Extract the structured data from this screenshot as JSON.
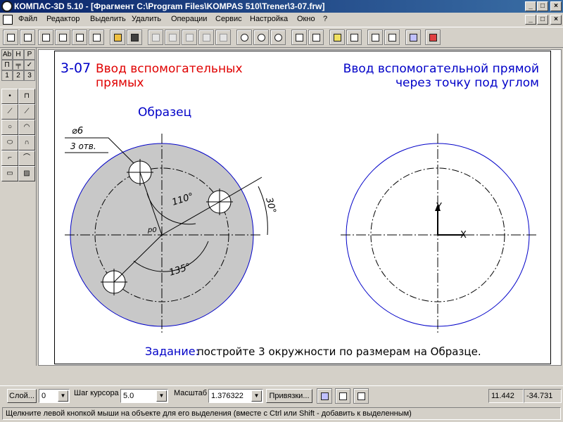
{
  "window": {
    "title": "КОМПАС-3D 5.10 - [Фрагмент C:\\Program Files\\KOMPAS 510\\Trener\\3-07.frw]"
  },
  "menu": {
    "items": [
      {
        "label": "Файл"
      },
      {
        "label": "Редактор"
      },
      {
        "label": "Выделить"
      },
      {
        "label": "Удалить"
      },
      {
        "label": "Операции"
      },
      {
        "label": "Сервис"
      },
      {
        "label": "Настройка"
      },
      {
        "label": "Окно"
      },
      {
        "label": "?"
      }
    ]
  },
  "left_panel": {
    "top_row1": [
      "Ab",
      "H",
      "P"
    ],
    "top_row2": [
      "П",
      "╤",
      "✓"
    ],
    "top_row3": [
      "1",
      "2",
      "3"
    ]
  },
  "drawing": {
    "exercise_number": "3-07",
    "exercise_title_line1": "Ввод вспомогательных",
    "exercise_title_line2": "прямых",
    "right_title_line1": "Ввод вспомогательной прямой",
    "right_title_line2": "через точку под углом",
    "sample_label": "Образец",
    "dim_diameter": "⌀6",
    "dim_holes": "3 отв.",
    "dim_angle_110": "110°",
    "dim_angle_30": "30°",
    "dim_angle_135": "135°",
    "dim_r0": "р0",
    "axis_y": "Y",
    "axis_x": "X",
    "task_label": "Задание:",
    "task_text": "постройте 3 окружности по размерам на Образце.",
    "colors": {
      "title_red": "#e00000",
      "title_blue": "#0000c8",
      "circle_blue": "#0000c8",
      "fill_gray": "#c8c8c8"
    }
  },
  "status": {
    "layer_button": "Слой...",
    "layer_value": "0",
    "step_label": "Шаг курсора",
    "step_value": "5.0",
    "scale_label": "Масштаб",
    "scale_value": "1.376322",
    "snap_button": "Привязки...",
    "coord_x": "11.442",
    "coord_y": "-34.731"
  },
  "hint": {
    "text": "Щелкните левой кнопкой мыши на объекте для его выделения (вместе с Ctrl или Shift - добавить к выделенным)"
  }
}
